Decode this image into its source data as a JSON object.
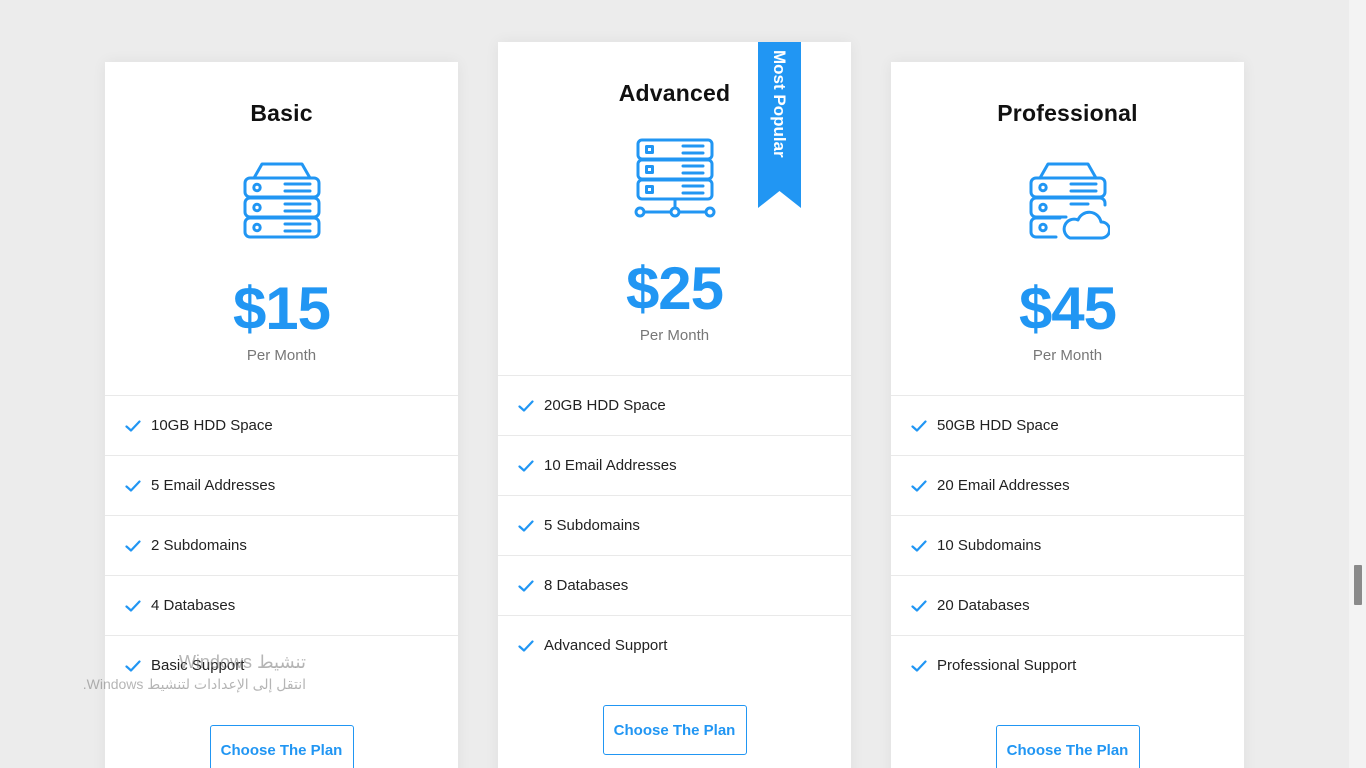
{
  "accent_color": "#2196f3",
  "plans": [
    {
      "title": "Basic",
      "icon": "server-stack-icon",
      "price": "$15",
      "period": "Per Month",
      "features": [
        "10GB HDD Space",
        "5 Email Addresses",
        "2 Subdomains",
        "4 Databases",
        "Basic Support"
      ],
      "button_label": "Choose The Plan"
    },
    {
      "title": "Advanced",
      "icon": "server-network-icon",
      "price": "$25",
      "period": "Per Month",
      "badge": "Most Popular",
      "features": [
        "20GB HDD Space",
        "10 Email Addresses",
        "5 Subdomains",
        "8 Databases",
        "Advanced Support"
      ],
      "button_label": "Choose The Plan"
    },
    {
      "title": "Professional",
      "icon": "server-cloud-icon",
      "price": "$45",
      "period": "Per Month",
      "features": [
        "50GB HDD Space",
        "20 Email Addresses",
        "10 Subdomains",
        "20 Databases",
        "Professional Support"
      ],
      "button_label": "Choose The Plan"
    }
  ],
  "activation_watermark": {
    "title": "تنشيط Windows",
    "subtitle": "انتقل إلى الإعدادات لتنشيط Windows."
  }
}
